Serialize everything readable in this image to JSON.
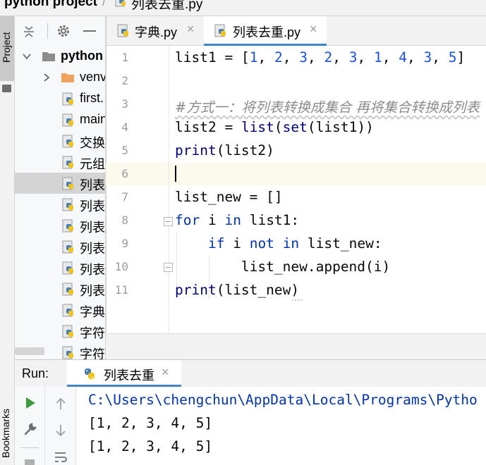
{
  "breadcrumb": {
    "project": "python project",
    "separator": "/",
    "file": "列表去重.py",
    "file_icon": "python-file-icon"
  },
  "left_strip": {
    "project_label": "Project",
    "bookmarks_label": "Bookmarks"
  },
  "project_tree": {
    "root_label": "python",
    "items": [
      {
        "label": "venv",
        "icon": "folder-icon"
      },
      {
        "label": "first.",
        "icon": "python-file-icon"
      },
      {
        "label": "main",
        "icon": "python-file-icon"
      },
      {
        "label": "交换",
        "icon": "python-file-icon"
      },
      {
        "label": "元组",
        "icon": "python-file-icon"
      },
      {
        "label": "列表",
        "icon": "python-file-icon",
        "selected": true
      },
      {
        "label": "列表",
        "icon": "python-file-icon"
      },
      {
        "label": "列表",
        "icon": "python-file-icon"
      },
      {
        "label": "列表",
        "icon": "python-file-icon"
      },
      {
        "label": "列表",
        "icon": "python-file-icon"
      },
      {
        "label": "列表",
        "icon": "python-file-icon"
      },
      {
        "label": "字典",
        "icon": "python-file-icon"
      },
      {
        "label": "字符",
        "icon": "python-file-icon"
      },
      {
        "label": "字符",
        "icon": "python-file-icon"
      }
    ]
  },
  "tabs": [
    {
      "label": "字典.py",
      "close": "×",
      "active": false
    },
    {
      "label": "列表去重.py",
      "close": "×",
      "active": true
    }
  ],
  "editor": {
    "line_numbers": [
      "1",
      "2",
      "3",
      "4",
      "5",
      "6",
      "7",
      "8",
      "9",
      "10",
      "11"
    ],
    "current_line": 6,
    "lines": [
      "list1 = [1, 2, 3, 2, 3, 1, 4, 3, 5]",
      "",
      "#方式一：将列表转换成集合 再将集合转换成列表",
      "list2 = list(set(list1))",
      "print(list2)",
      "",
      "list_new = []",
      "for i in list1:",
      "    if i not in list_new:",
      "        list_new.append(i)",
      "print(list_new)"
    ]
  },
  "run_panel": {
    "label": "Run:",
    "tab_label": "列表去重",
    "tab_close": "×",
    "console_lines": [
      "C:\\Users\\chengchun\\AppData\\Local\\Programs\\Pytho",
      "[1, 2, 3, 4, 5]",
      "[1, 2, 3, 4, 5]"
    ]
  },
  "colors": {
    "keyword": "#0033b3",
    "number": "#1750eb",
    "builtin": "#000080",
    "comment": "#8c8c8c",
    "accent": "#4083c9",
    "run_green": "#3d9a3d"
  }
}
